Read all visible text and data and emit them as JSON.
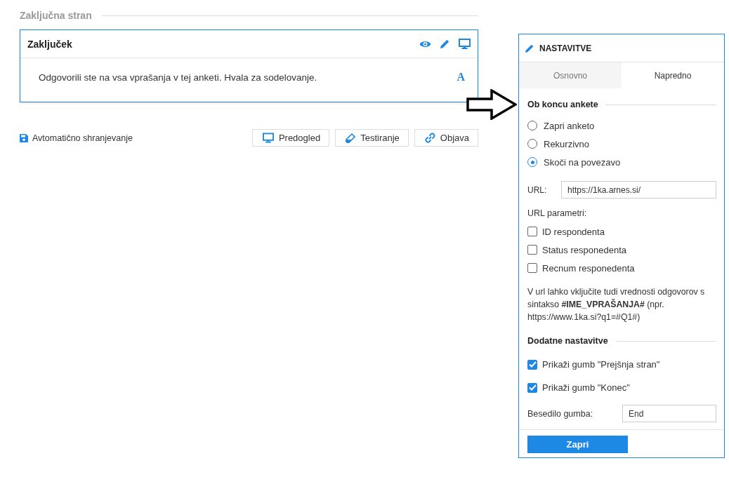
{
  "section_title": "Zaključna stran",
  "card": {
    "title": "Zaključek",
    "text": "Odgovorili ste na vsa vprašanja v tej anketi. Hvala za sodelovanje.",
    "font_glyph": "A"
  },
  "autosave": "Avtomatično shranjevanje",
  "actions": [
    {
      "label": "Predogled",
      "kind": "monitor"
    },
    {
      "label": "Testiranje",
      "kind": "flask"
    },
    {
      "label": "Objava",
      "kind": "link"
    }
  ],
  "settings": {
    "title": "NASTAVITVE",
    "tabs": [
      {
        "label": "Osnovno",
        "selected": false
      },
      {
        "label": "Napredno",
        "selected": true
      }
    ],
    "end_section": "Ob koncu ankete",
    "radios": [
      {
        "label": "Zapri anketo",
        "selected": false
      },
      {
        "label": "Rekurzivno",
        "selected": false
      },
      {
        "label": "Skoči na povezavo",
        "selected": true
      }
    ],
    "url_label": "URL:",
    "url_value": "https://1ka.arnes.si/",
    "params_label": "URL parametri:",
    "params": [
      {
        "label": "ID respondenta",
        "checked": false
      },
      {
        "label": "Status responedenta",
        "checked": false
      },
      {
        "label": "Recnum responedenta",
        "checked": false
      }
    ],
    "hint": "V url lahko vključite tudi vrednosti odgovorov s sintakso **#IME_VPRAŠANJA#** (npr. https://www.1ka.si?q1=#Q1#)",
    "extra_section": "Dodatne nastavitve",
    "extras": [
      {
        "label": "Prikaži gumb \"Prejšnja stran\"",
        "checked": true
      },
      {
        "label": "Prikaži gumb \"Konec\"",
        "checked": true
      }
    ],
    "button_text_label": "Besedilo gumba:",
    "button_text_value": "End",
    "close": "Zapri"
  }
}
